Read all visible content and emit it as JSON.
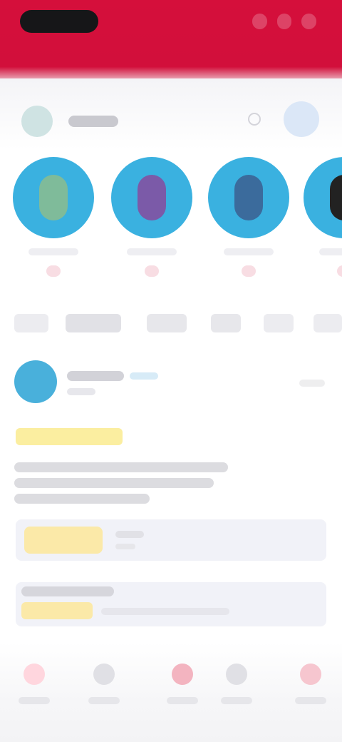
{
  "colors": {
    "brand": "#d50f3b",
    "story_ring": "#3ab1e0",
    "tag_yellow": "#fbeea0",
    "card_bg": "#f1f2f8"
  },
  "header": {
    "pill_icon": "app-logo-pill",
    "actions": [
      "bell-icon",
      "chat-icon",
      "more-icon"
    ]
  },
  "topbar": {
    "search_icon": "search-icon"
  },
  "stories": [
    {
      "center_color": "#7fbb9a"
    },
    {
      "center_color": "#7b5aa8"
    },
    {
      "center_color": "#3b6b9c"
    },
    {
      "center_color": "#222222"
    }
  ],
  "tabs": [
    {
      "label": "",
      "active": true
    },
    {
      "label": "",
      "active": false
    },
    {
      "label": "",
      "active": false
    },
    {
      "label": "",
      "active": false
    },
    {
      "label": "",
      "active": false
    },
    {
      "label": "",
      "active": false
    }
  ],
  "bottom_nav": [
    {
      "icon": "home-icon",
      "color": "#ffd6de"
    },
    {
      "icon": "discover-icon",
      "color": "#e0e0e5"
    },
    {
      "icon": "create-icon",
      "color": "#f3b4c0"
    },
    {
      "icon": "messages-icon",
      "color": "#e0e0e5"
    },
    {
      "icon": "profile-icon",
      "color": "#f6c6cf"
    }
  ]
}
